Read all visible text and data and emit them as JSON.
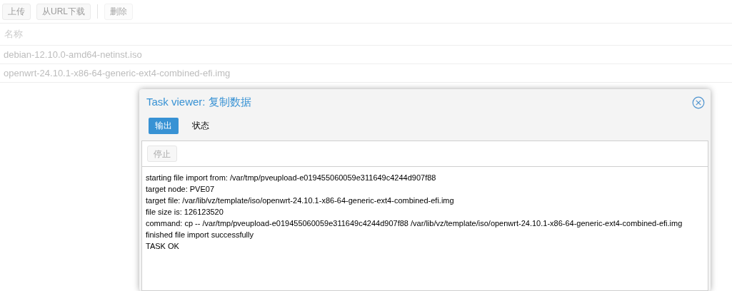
{
  "toolbar": [
    {
      "label": "上传",
      "disabled": false
    },
    {
      "label": "从URL下载",
      "disabled": false
    },
    {
      "label": "删除",
      "disabled": true
    }
  ],
  "table": {
    "columns": [
      "名称"
    ],
    "rows": [
      "debian-12.10.0-amd64-netinst.iso",
      "openwrt-24.10.1-x86-64-generic-ext4-combined-efi.img"
    ]
  },
  "dialog": {
    "title_prefix": "Task viewer:",
    "title": "复制数据",
    "tabs": [
      {
        "label": "输出",
        "selected": true
      },
      {
        "label": "状态",
        "selected": false
      }
    ],
    "stop_button": {
      "label": "停止",
      "disabled": true
    },
    "log": [
      "starting file import from: /var/tmp/pveupload-e019455060059e311649c4244d907f88",
      "target node: PVE07",
      "target file: /var/lib/vz/template/iso/openwrt-24.10.1-x86-64-generic-ext4-combined-efi.img",
      "file size is: 126123520",
      "command: cp -- /var/tmp/pveupload-e019455060059e311649c4244d907f88 /var/lib/vz/template/iso/openwrt-24.10.1-x86-64-generic-ext4-combined-efi.img",
      "finished file import successfully",
      "TASK OK"
    ]
  }
}
